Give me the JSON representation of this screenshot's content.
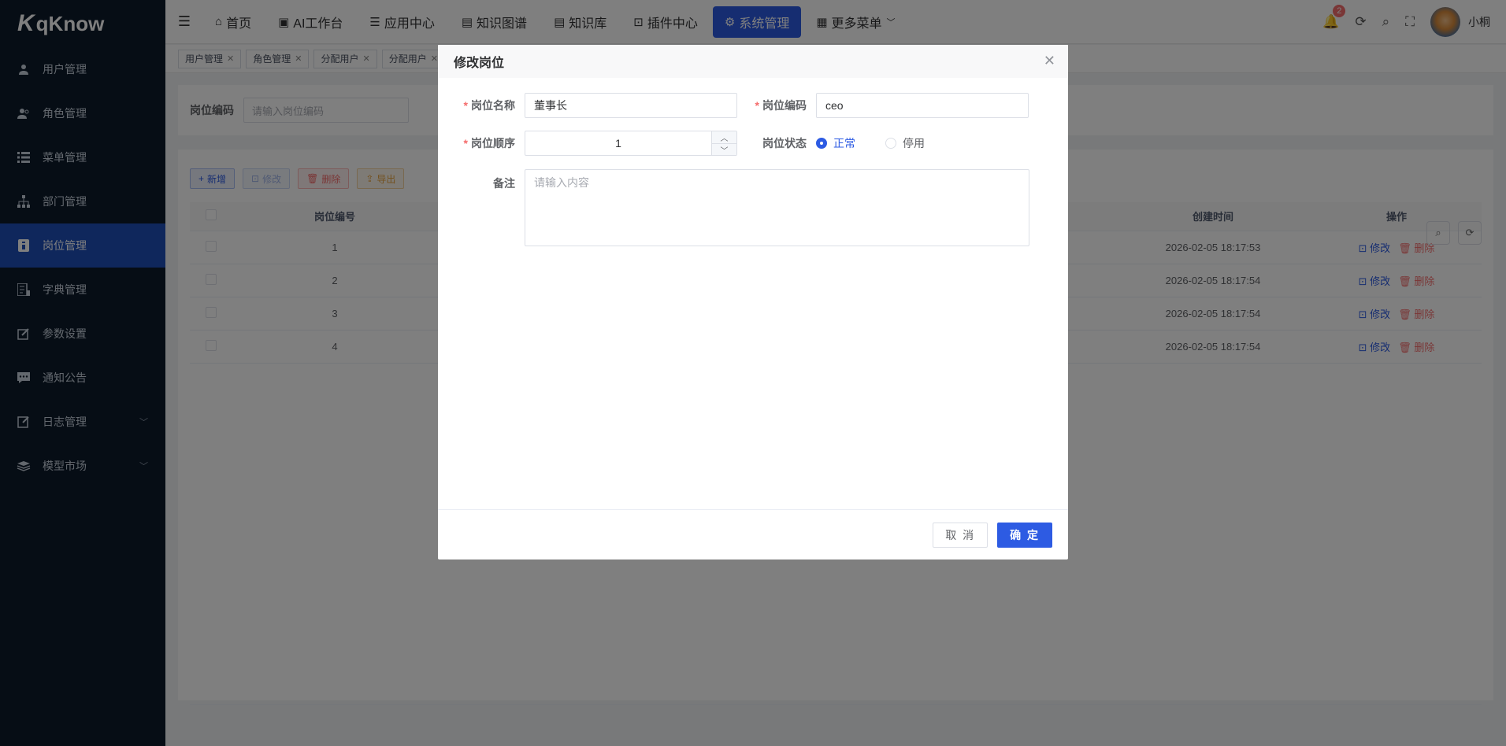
{
  "brand": {
    "name": "qKnow"
  },
  "sidebar": {
    "items": [
      {
        "label": "用户管理",
        "icon": "user-icon"
      },
      {
        "label": "角色管理",
        "icon": "role-icon"
      },
      {
        "label": "菜单管理",
        "icon": "menu-list-icon"
      },
      {
        "label": "部门管理",
        "icon": "org-tree-icon"
      },
      {
        "label": "岗位管理",
        "icon": "post-icon",
        "active": true
      },
      {
        "label": "字典管理",
        "icon": "dict-icon"
      },
      {
        "label": "参数设置",
        "icon": "edit-icon"
      },
      {
        "label": "通知公告",
        "icon": "message-icon"
      },
      {
        "label": "日志管理",
        "icon": "log-icon",
        "expandable": true
      },
      {
        "label": "模型市场",
        "icon": "model-icon",
        "expandable": true
      }
    ]
  },
  "navbar": {
    "items": [
      {
        "label": "首页",
        "icon": "home-icon"
      },
      {
        "label": "AI工作台",
        "icon": "monitor-icon"
      },
      {
        "label": "应用中心",
        "icon": "stack-icon"
      },
      {
        "label": "知识图谱",
        "icon": "book-icon"
      },
      {
        "label": "知识库",
        "icon": "library-icon"
      },
      {
        "label": "插件中心",
        "icon": "plugin-icon"
      },
      {
        "label": "系统管理",
        "icon": "gear-icon",
        "active": true
      },
      {
        "label": "更多菜单",
        "icon": "more-icon"
      }
    ],
    "notification_count": "2",
    "username": "小桐"
  },
  "tags": [
    "用户管理",
    "角色管理",
    "分配用户",
    "分配用户"
  ],
  "search": {
    "label": "岗位编码",
    "placeholder": "请输入岗位编码"
  },
  "toolbar": {
    "add": "新增",
    "edit": "修改",
    "delete": "删除",
    "export": "导出"
  },
  "table": {
    "headers": {
      "id": "岗位编号",
      "created": "创建时间",
      "ops": "操作"
    },
    "rows": [
      {
        "id": "1",
        "created": "2026-02-05 18:17:53"
      },
      {
        "id": "2",
        "created": "2026-02-05 18:17:54"
      },
      {
        "id": "3",
        "created": "2026-02-05 18:17:54"
      },
      {
        "id": "4",
        "created": "2026-02-05 18:17:54"
      }
    ],
    "op_edit": "修改",
    "op_delete": "删除"
  },
  "dialog": {
    "title": "修改岗位",
    "fields": {
      "name_label": "岗位名称",
      "name_value": "董事长",
      "code_label": "岗位编码",
      "code_value": "ceo",
      "order_label": "岗位顺序",
      "order_value": "1",
      "status_label": "岗位状态",
      "status_normal": "正常",
      "status_disabled": "停用",
      "remark_label": "备注",
      "remark_placeholder": "请输入内容"
    },
    "cancel": "取 消",
    "confirm": "确 定"
  },
  "colors": {
    "primary": "#2d5be3",
    "danger": "#f56c6c",
    "sidebar": "#0d1b2a"
  }
}
